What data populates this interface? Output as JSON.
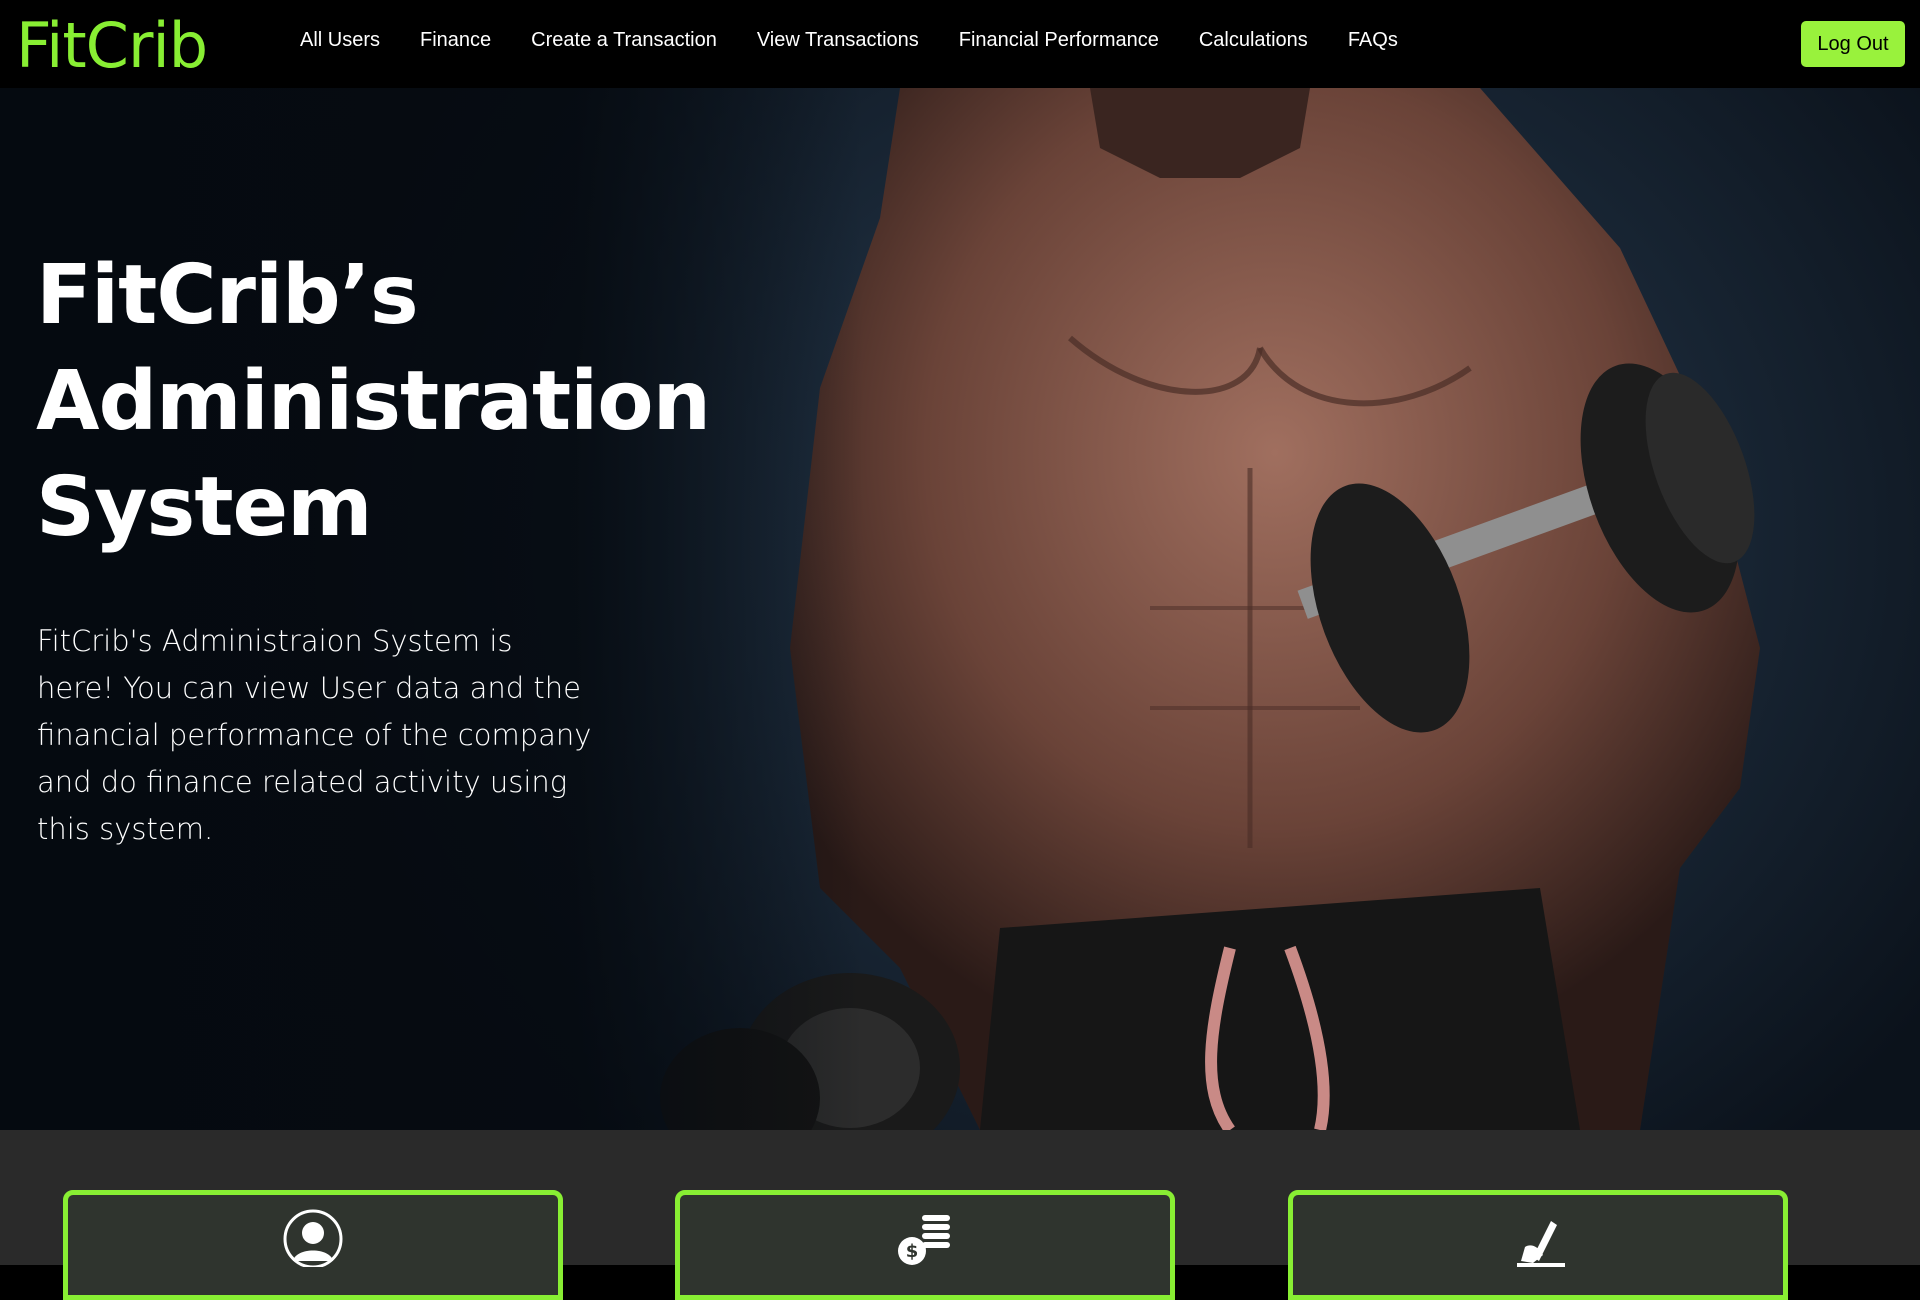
{
  "brand": "FitCrib",
  "nav": {
    "items": [
      {
        "label": "All Users"
      },
      {
        "label": "Finance"
      },
      {
        "label": "Create a Transaction"
      },
      {
        "label": "View Transactions"
      },
      {
        "label": "Financial Performance"
      },
      {
        "label": "Calculations"
      },
      {
        "label": "FAQs"
      }
    ],
    "logout_label": "Log Out"
  },
  "hero": {
    "title_lines": [
      "FitCrib’s",
      "Administration",
      "System"
    ],
    "description": "FitCrib's Administraion System is here! You can view User data and the financial performance of the company and do finance related activity using this system."
  },
  "features": {
    "cards": [
      {
        "icon": "user-icon"
      },
      {
        "icon": "coins-dollar-icon"
      },
      {
        "icon": "signing-hand-icon"
      }
    ]
  },
  "colors": {
    "accent": "#88ee33",
    "navbar_bg": "#000000",
    "features_bg": "#2a2a2a"
  }
}
